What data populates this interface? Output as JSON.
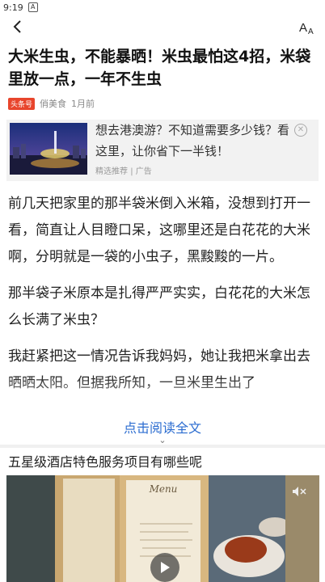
{
  "status_bar": {
    "time": "9:19"
  },
  "article": {
    "title": "大米生虫，不能暴晒！米虫最怕这4招，米袋里放一点，一年不生虫",
    "badge": "头条号",
    "author": "俏美食",
    "date": "1月前",
    "paragraphs": [
      "前几天把家里的那半袋米倒入米箱，没想到打开一看，简直让人目瞪口呆，这哪里还是白花花的大米啊，分明就是一袋的小虫子，黑黢黢的一片。",
      "那半袋子米原本是扎得严严实实，白花花的大米怎么长满了米虫？",
      "我赶紧把这一情况告诉我妈妈，她让我把米拿出去晒晒太阳。但据我所知，一旦米里生出了"
    ],
    "read_more": "点击阅读全文"
  },
  "ad": {
    "headline": "想去港澳游？不知道需要多少钱？看这里，让你省下一半钱！",
    "sub_label": "精选推荐",
    "ad_label": "广告"
  },
  "recommend": {
    "title": "五星级酒店特色服务项目有哪些呢",
    "menu_text": "Menu"
  },
  "icons": {
    "back": "back-arrow-icon",
    "font_size": "font-size-icon",
    "close": "close-icon",
    "mute": "mute-icon",
    "play": "play-icon"
  },
  "colors": {
    "badge_red": "#e8452c",
    "link_blue": "#2b6cd0"
  }
}
